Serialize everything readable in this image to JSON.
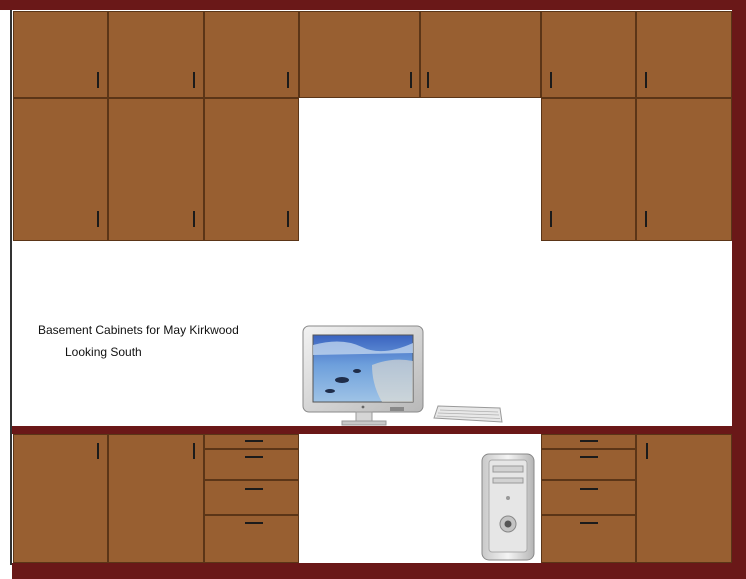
{
  "drawing": {
    "title": "Basement Cabinets for May Kirkwood",
    "subtitle": "Looking South"
  },
  "colors": {
    "cabinet_wood": "#985f31",
    "cabinet_edge": "#5b3517",
    "trim": "#6a1818",
    "handle": "#1b1b1b"
  },
  "icons": {
    "monitor": "cinema-display-icon",
    "keyboard": "keyboard-icon",
    "computer": "tower-computer-icon"
  }
}
